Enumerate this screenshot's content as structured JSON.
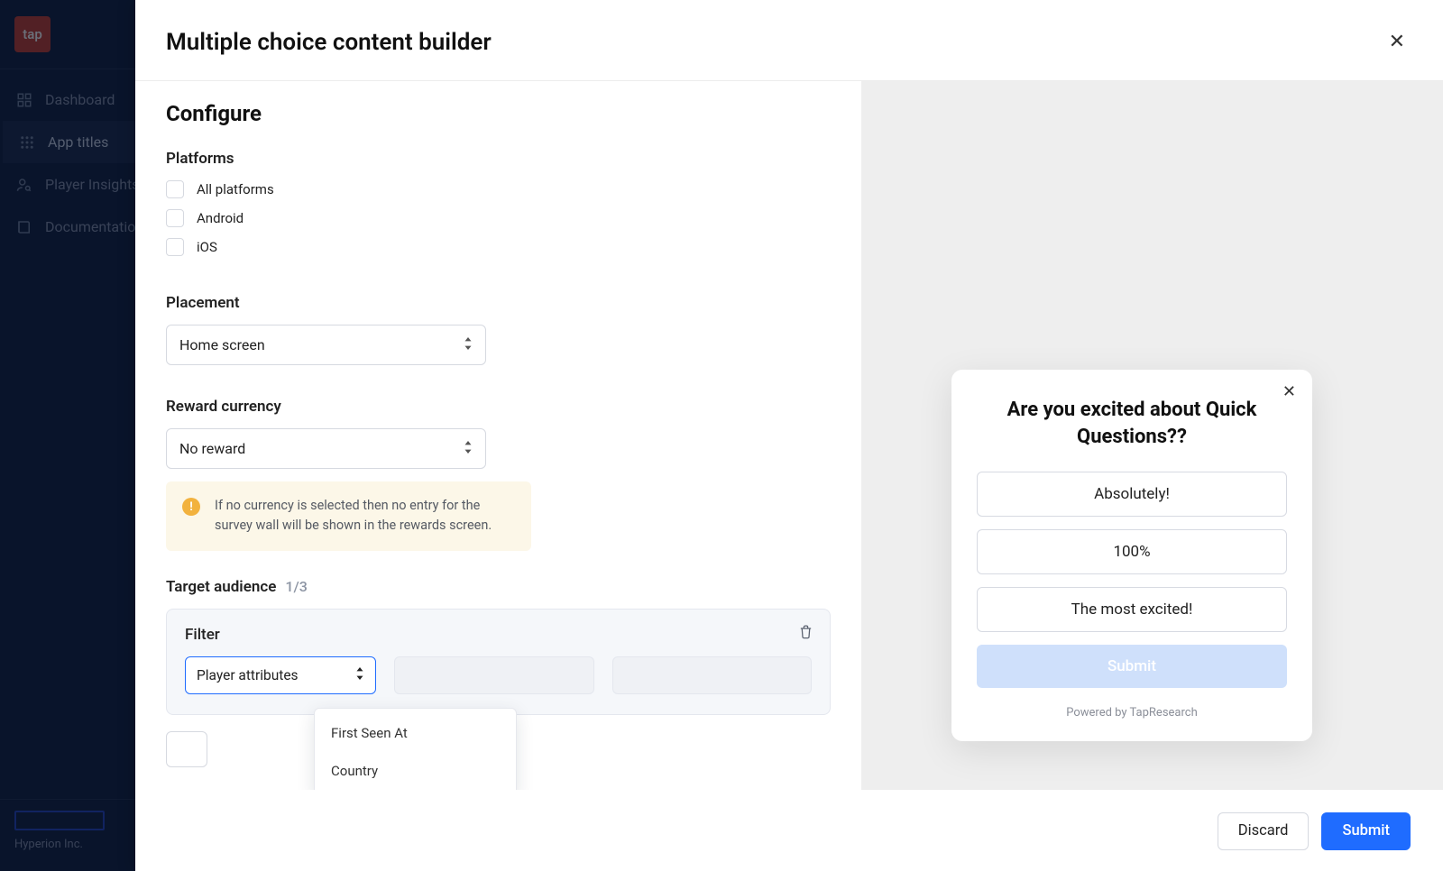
{
  "brand": {
    "logo_text": "tap",
    "account_name": "Hyperion Inc."
  },
  "sidebar": {
    "items": [
      {
        "label": "Dashboard"
      },
      {
        "label": "App titles"
      },
      {
        "label": "Player Insights"
      },
      {
        "label": "Documentation"
      }
    ]
  },
  "modal": {
    "title": "Multiple choice content builder",
    "section_title": "Configure",
    "platforms": {
      "label": "Platforms",
      "options": [
        {
          "label": "All platforms"
        },
        {
          "label": "Android"
        },
        {
          "label": "iOS"
        }
      ]
    },
    "placement": {
      "label": "Placement",
      "value": "Home screen"
    },
    "reward": {
      "label": "Reward currency",
      "value": "No reward",
      "alert": "If no currency is selected then no entry for the survey wall will be shown in the rewards screen."
    },
    "target_audience": {
      "label": "Target audience",
      "count": "1/3",
      "filter_title": "Filter",
      "attr_select_value": "Player attributes",
      "dropdown_options": [
        "First Seen At",
        "Country"
      ]
    },
    "footer": {
      "discard": "Discard",
      "submit": "Submit"
    }
  },
  "preview": {
    "question": "Are you excited about Quick Questions??",
    "options": [
      "Absolutely!",
      "100%",
      "The most excited!"
    ],
    "submit": "Submit",
    "powered": "Powered by TapResearch"
  }
}
